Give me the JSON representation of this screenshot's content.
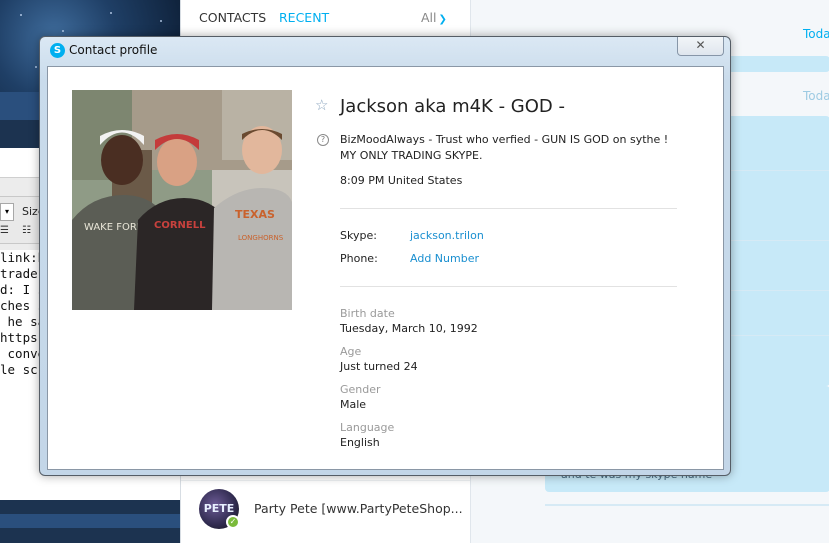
{
  "left_app": {
    "toolbar": {
      "size_label": "Size"
    },
    "code_lines": [
      "link:h",
      "trade:",
      "d: I se",
      "ches s",
      " he sa",
      "https:/",
      " conve",
      "le scre"
    ]
  },
  "contacts": {
    "tabs": {
      "contacts": "CONTACTS",
      "recent": "RECENT"
    },
    "filter": {
      "label": "All"
    },
    "row": {
      "avatar_text": "PETE",
      "name": "Party Pete [www.PartyPeteShop..."
    }
  },
  "chat": {
    "today_1": "Toda",
    "today_2": "Toda",
    "partial_message": "and te was my skype name"
  },
  "dialog": {
    "title": "Contact profile",
    "close_glyph": "✕",
    "profile": {
      "display_name": "Jackson aka m4K - GOD -",
      "mood": "BizMoodAlways - Trust who verfied - GUN IS GOD on sythe ! MY ONLY TRADING SKYPE.",
      "local_time": "8:09 PM United States",
      "skype_label": "Skype:",
      "skype_value": "jackson.trilon",
      "phone_label": "Phone:",
      "phone_value": "Add Number",
      "birth_label": "Birth date",
      "birth_value": "Tuesday, March 10, 1992",
      "age_label": "Age",
      "age_value": "Just turned 24",
      "gender_label": "Gender",
      "gender_value": "Male",
      "language_label": "Language",
      "language_value": "English"
    },
    "photo": {
      "shirt_texts": [
        "WAKE FOREST",
        "CORNELL",
        "TEXAS",
        "LONGHORNS"
      ]
    }
  },
  "colors": {
    "skype_blue": "#00aff0",
    "link_blue": "#1a8fd0",
    "presence_green": "#7bbb3b"
  }
}
